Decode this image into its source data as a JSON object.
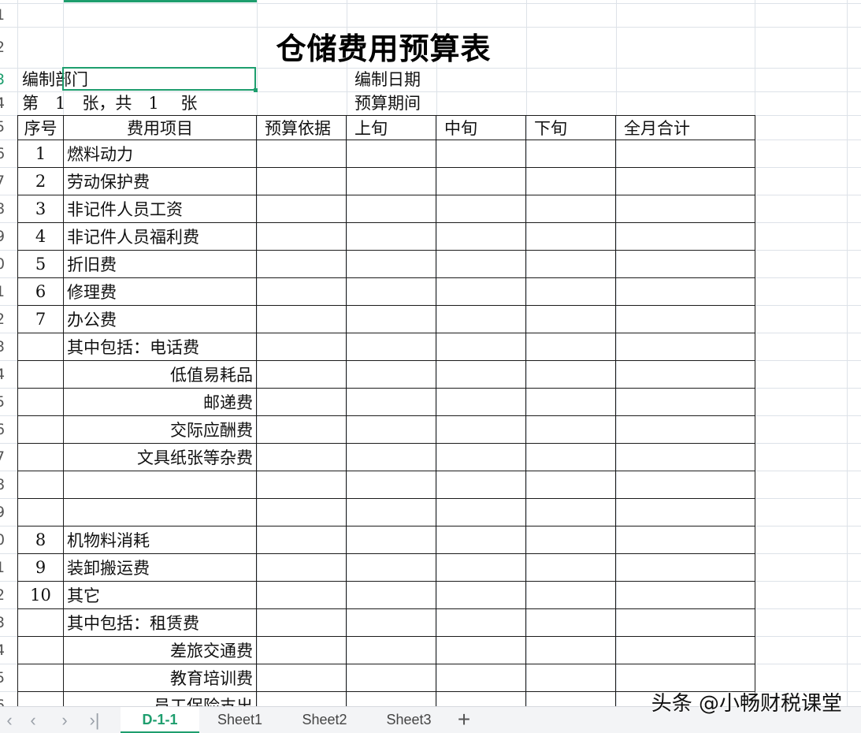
{
  "title": "仓储费用预算表",
  "row_headers": [
    "1",
    "2",
    "3",
    "4",
    "5",
    "6",
    "7",
    "8",
    "9",
    "0",
    "1",
    "2",
    "3",
    "4",
    "5",
    "6",
    "7",
    "8",
    "9",
    "0",
    "1",
    "2",
    "3",
    "4",
    "5",
    "6"
  ],
  "active_row_header": "3",
  "info": {
    "dept_label": "编制部门",
    "page_info": "第　1　张，共　1　 张",
    "date_label": "编制日期",
    "period_label": "预算期间"
  },
  "table": {
    "headers": [
      "序号",
      "费用项目",
      "预算依据",
      "上旬",
      "中旬",
      "下旬",
      "全月合计"
    ],
    "rows": [
      {
        "no": "1",
        "item": "燃料动力",
        "indent": false
      },
      {
        "no": "2",
        "item": "劳动保护费",
        "indent": false
      },
      {
        "no": "3",
        "item": "非记件人员工资",
        "indent": false
      },
      {
        "no": "4",
        "item": "非记件人员福利费",
        "indent": false
      },
      {
        "no": "5",
        "item": "折旧费",
        "indent": false
      },
      {
        "no": "6",
        "item": "修理费",
        "indent": false
      },
      {
        "no": "7",
        "item": "办公费",
        "indent": false
      },
      {
        "no": "",
        "item": "其中包括：电话费",
        "indent": false
      },
      {
        "no": "",
        "item": "低值易耗品",
        "indent": true
      },
      {
        "no": "",
        "item": "邮递费",
        "indent": true
      },
      {
        "no": "",
        "item": "交际应酬费",
        "indent": true
      },
      {
        "no": "",
        "item": "文具纸张等杂费",
        "indent": true
      },
      {
        "no": "",
        "item": "",
        "indent": false
      },
      {
        "no": "",
        "item": "",
        "indent": false
      },
      {
        "no": "8",
        "item": "机物料消耗",
        "indent": false
      },
      {
        "no": "9",
        "item": "装卸搬运费",
        "indent": false
      },
      {
        "no": "10",
        "item": "其它",
        "indent": false
      },
      {
        "no": "",
        "item": "其中包括：租赁费",
        "indent": false
      },
      {
        "no": "",
        "item": "差旅交通费",
        "indent": true
      },
      {
        "no": "",
        "item": "教育培训费",
        "indent": true
      },
      {
        "no": "",
        "item": "员工保险支出",
        "indent": true
      }
    ]
  },
  "tabs": {
    "nav_first": "|<",
    "nav_prev": "<",
    "nav_next": ">",
    "nav_last": ">|",
    "sheets": [
      "D-1-1",
      "Sheet1",
      "Sheet2",
      "Sheet3"
    ],
    "active": "D-1-1",
    "add": "+"
  },
  "watermark": "头条 @小畅财税课堂"
}
